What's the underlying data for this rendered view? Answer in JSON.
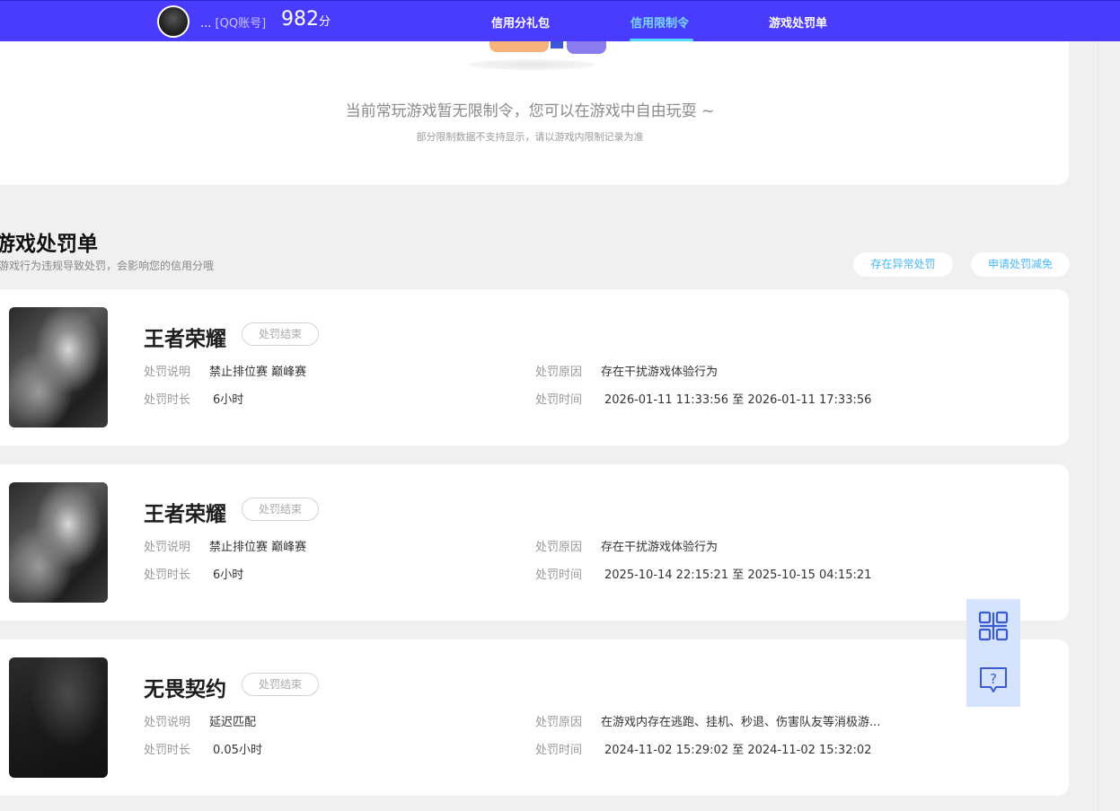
{
  "header": {
    "account_dots": "...",
    "account_label": "[QQ账号]",
    "score_value": "982",
    "score_unit": "分",
    "tabs": [
      {
        "label": "信用分礼包",
        "active": false
      },
      {
        "label": "信用限制令",
        "active": true
      },
      {
        "label": "游戏处罚单",
        "active": false
      }
    ],
    "colors": {
      "bar": "#4a3cff",
      "active_tab": "#7ad8ff"
    }
  },
  "restriction": {
    "empty_message": "当前常玩游戏暂无限制令，您可以在游戏中自由玩耍 ~",
    "empty_note": "部分限制数据不支持显示，请以游戏内限制记录为准"
  },
  "penalty_section": {
    "title": "游戏处罚单",
    "description": "游戏行为违规导致处罚，会影响您的信用分哦",
    "buttons": {
      "abnormal": "存在异常处罚",
      "reduce": "申请处罚减免"
    }
  },
  "penalties": [
    {
      "game": "王者荣耀",
      "status": "处罚结束",
      "desc_label": "处罚说明",
      "desc": "禁止排位赛 巅峰赛",
      "duration_label": "处罚时长",
      "duration": "6小时",
      "reason_label": "处罚原因",
      "reason": "存在干扰游戏体验行为",
      "time_label": "处罚时间",
      "time": "2026-01-11 11:33:56 至 2026-01-11 17:33:56"
    },
    {
      "game": "王者荣耀",
      "status": "处罚结束",
      "desc_label": "处罚说明",
      "desc": "禁止排位赛 巅峰赛",
      "duration_label": "处罚时长",
      "duration": "6小时",
      "reason_label": "处罚原因",
      "reason": "存在干扰游戏体验行为",
      "time_label": "处罚时间",
      "time": "2025-10-14 22:15:21 至 2025-10-15 04:15:21"
    },
    {
      "game": "无畏契约",
      "status": "处罚结束",
      "desc_label": "处罚说明",
      "desc": "延迟匹配",
      "duration_label": "处罚时长",
      "duration": "0.05小时",
      "reason_label": "处罚原因",
      "reason": "在游戏内存在逃跑、挂机、秒退、伤害队友等消极游...",
      "time_label": "处罚时间",
      "time": "2024-11-02 15:29:02 至 2024-11-02 15:32:02"
    }
  ],
  "float_widget": {
    "icons": [
      "qr-code-icon",
      "help-chat-icon"
    ]
  }
}
